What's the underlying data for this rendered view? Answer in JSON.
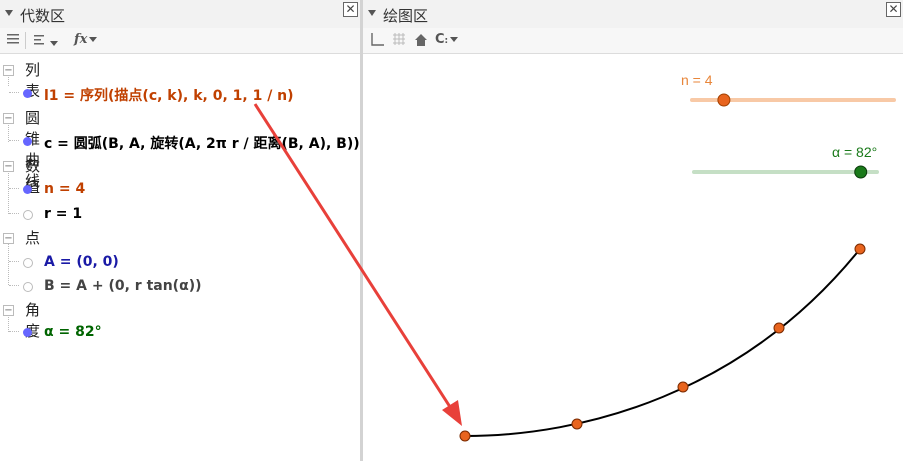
{
  "algebra": {
    "title": "代数区",
    "categories": [
      {
        "label": "列表",
        "items": [
          {
            "text": "l1 = 序列(描点(c, k), k, 0, 1, 1 / n)",
            "color": "#c04000",
            "shown": true
          }
        ]
      },
      {
        "label": "圆锥曲线",
        "items": [
          {
            "text": "c = 圆弧(B, A, 旋转(A, 2π r / 距离(B, A), B))",
            "color": "#000000",
            "shown": true
          }
        ]
      },
      {
        "label": "数值",
        "items": [
          {
            "text": "n = 4",
            "color": "#c04000",
            "shown": true
          },
          {
            "text": "r = 1",
            "color": "#000000",
            "shown": false
          }
        ]
      },
      {
        "label": "点",
        "items": [
          {
            "text": "A = (0, 0)",
            "color": "#1a1aa6",
            "shown": false
          },
          {
            "text": "B = A + (0, r tan(α))",
            "color": "#444444",
            "shown": false
          }
        ]
      },
      {
        "label": "角度",
        "items": [
          {
            "text": "α = 82°",
            "color": "#006400",
            "shown": true
          }
        ]
      }
    ]
  },
  "graphics": {
    "title": "绘图区",
    "slider_n": {
      "label": "n = 4",
      "value": 4,
      "min": 1,
      "max": 20,
      "color": "#e8863a"
    },
    "slider_alpha": {
      "label": "α = 82°",
      "value": 82,
      "min": 0,
      "max": 90,
      "color": "#1a7a1a"
    }
  },
  "toolbar_icons": [
    "menu-icon",
    "sort-icon",
    "fx-icon",
    "axes-icon",
    "grid-icon",
    "home-icon",
    "point-capture-icon"
  ],
  "colors": {
    "arrow": "#e8403a",
    "point_fill": "#e8641e",
    "curve": "#000000"
  }
}
